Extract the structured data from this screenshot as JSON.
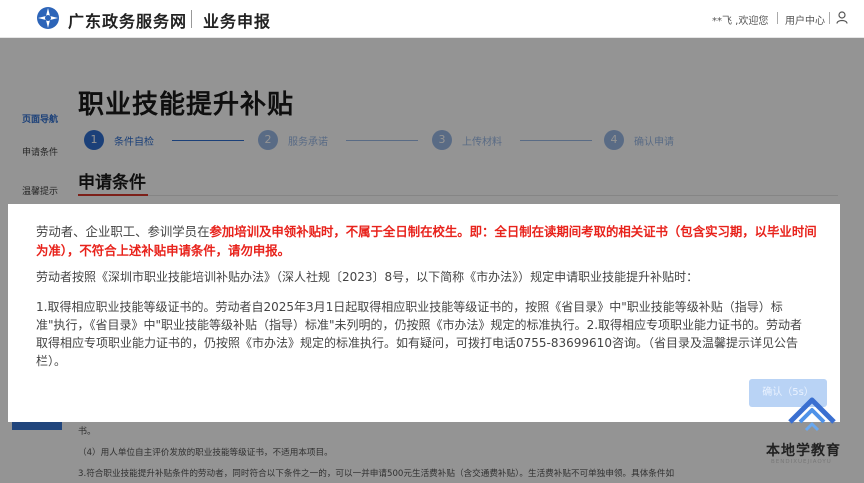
{
  "header": {
    "site_name": "广东政务服务网",
    "section_name": "业务申报",
    "user_greeting": "**飞 ,欢迎您",
    "user_center": "用户中心"
  },
  "sidebar": {
    "title": "页面导航",
    "items": [
      {
        "label": "申请条件"
      },
      {
        "label": "温馨提示"
      }
    ]
  },
  "main": {
    "page_title": "职业技能提升补贴",
    "steps": [
      {
        "num": "1",
        "label": "条件自检",
        "active": true
      },
      {
        "num": "2",
        "label": "服务承诺",
        "active": false
      },
      {
        "num": "3",
        "label": "上传材料",
        "active": false
      },
      {
        "num": "4",
        "label": "确认申请",
        "active": false
      }
    ],
    "section_title": "申请条件",
    "bg_fragment": "书。",
    "bg_line_4": "（4）用人单位自主评价发放的职业技能等级证书，不适用本项目。",
    "bg_line_5": "3.符合职业技能提升补贴条件的劳动者，同时符合以下条件之一的，可以一并申请500元生活费补贴（含交通费补贴）。生活费补贴不可单独申领。具体条件如"
  },
  "modal": {
    "p1_prefix": "劳动者、企业职工、参训学员在",
    "p1_red": "参加培训及申领补贴时，不属于全日制在校生。即：全日制在读期间考取的相关证书（包含实习期，以毕业时间为准），不符合上述补贴申请条件，请勿申报。",
    "p2": "劳动者按照《深圳市职业技能培训补贴办法》（深人社规〔2023〕8号，以下简称《市办法》）规定申请职业技能提升补贴时：",
    "p3": "1.取得相应职业技能等级证书的。劳动者自2025年3月1日起取得相应职业技能等级证书的，按照《省目录》中\"职业技能等级补贴（指导）标准\"执行，《省目录》中\"职业技能等级补贴（指导）标准\"未列明的，仍按照《市办法》规定的标准执行。2.取得相应专项职业能力证书的。劳动者取得相应专项职业能力证书的，仍按照《市办法》规定的标准执行。如有疑问，可拨打电话0755-83699610咨询。（省目录及温馨提示详见公告栏）。",
    "confirm_label": "确认（5s）"
  },
  "watermark": {
    "text": "本地学教育",
    "sub": "BENDIXUEJIAOYU"
  },
  "colors": {
    "accent_blue": "#2f6fd0",
    "alert_red": "#e8231c",
    "button_disabled": "#b9d3f5"
  }
}
